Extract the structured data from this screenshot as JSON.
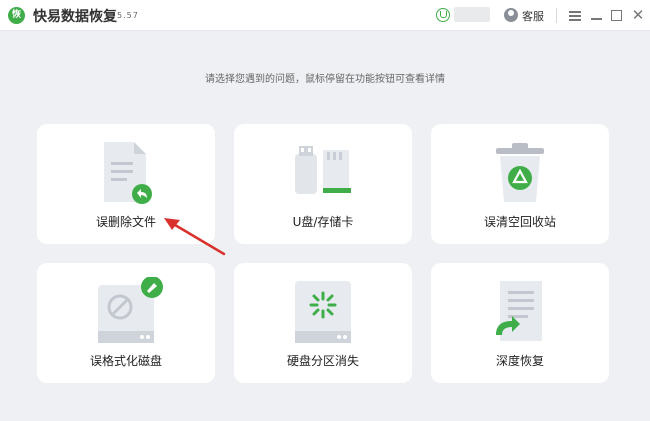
{
  "titlebar": {
    "app_name": "快易数据恢复",
    "version": "5.57",
    "logo_text": "恢",
    "support_label": "客服"
  },
  "hint": "请选择您遇到的问题，鼠标停留在功能按钮可查看详情",
  "cards": [
    {
      "label": "误删除文件",
      "icon": "deleted-file-icon"
    },
    {
      "label": "U盘/存储卡",
      "icon": "usb-sdcard-icon"
    },
    {
      "label": "误清空回收站",
      "icon": "recycle-bin-icon"
    },
    {
      "label": "误格式化磁盘",
      "icon": "formatted-disk-icon"
    },
    {
      "label": "硬盘分区消失",
      "icon": "lost-partition-icon"
    },
    {
      "label": "深度恢复",
      "icon": "deep-recovery-icon"
    }
  ],
  "colors": {
    "accent": "#3fae49",
    "annotation": "#d9312b",
    "background": "#eef0f3"
  }
}
